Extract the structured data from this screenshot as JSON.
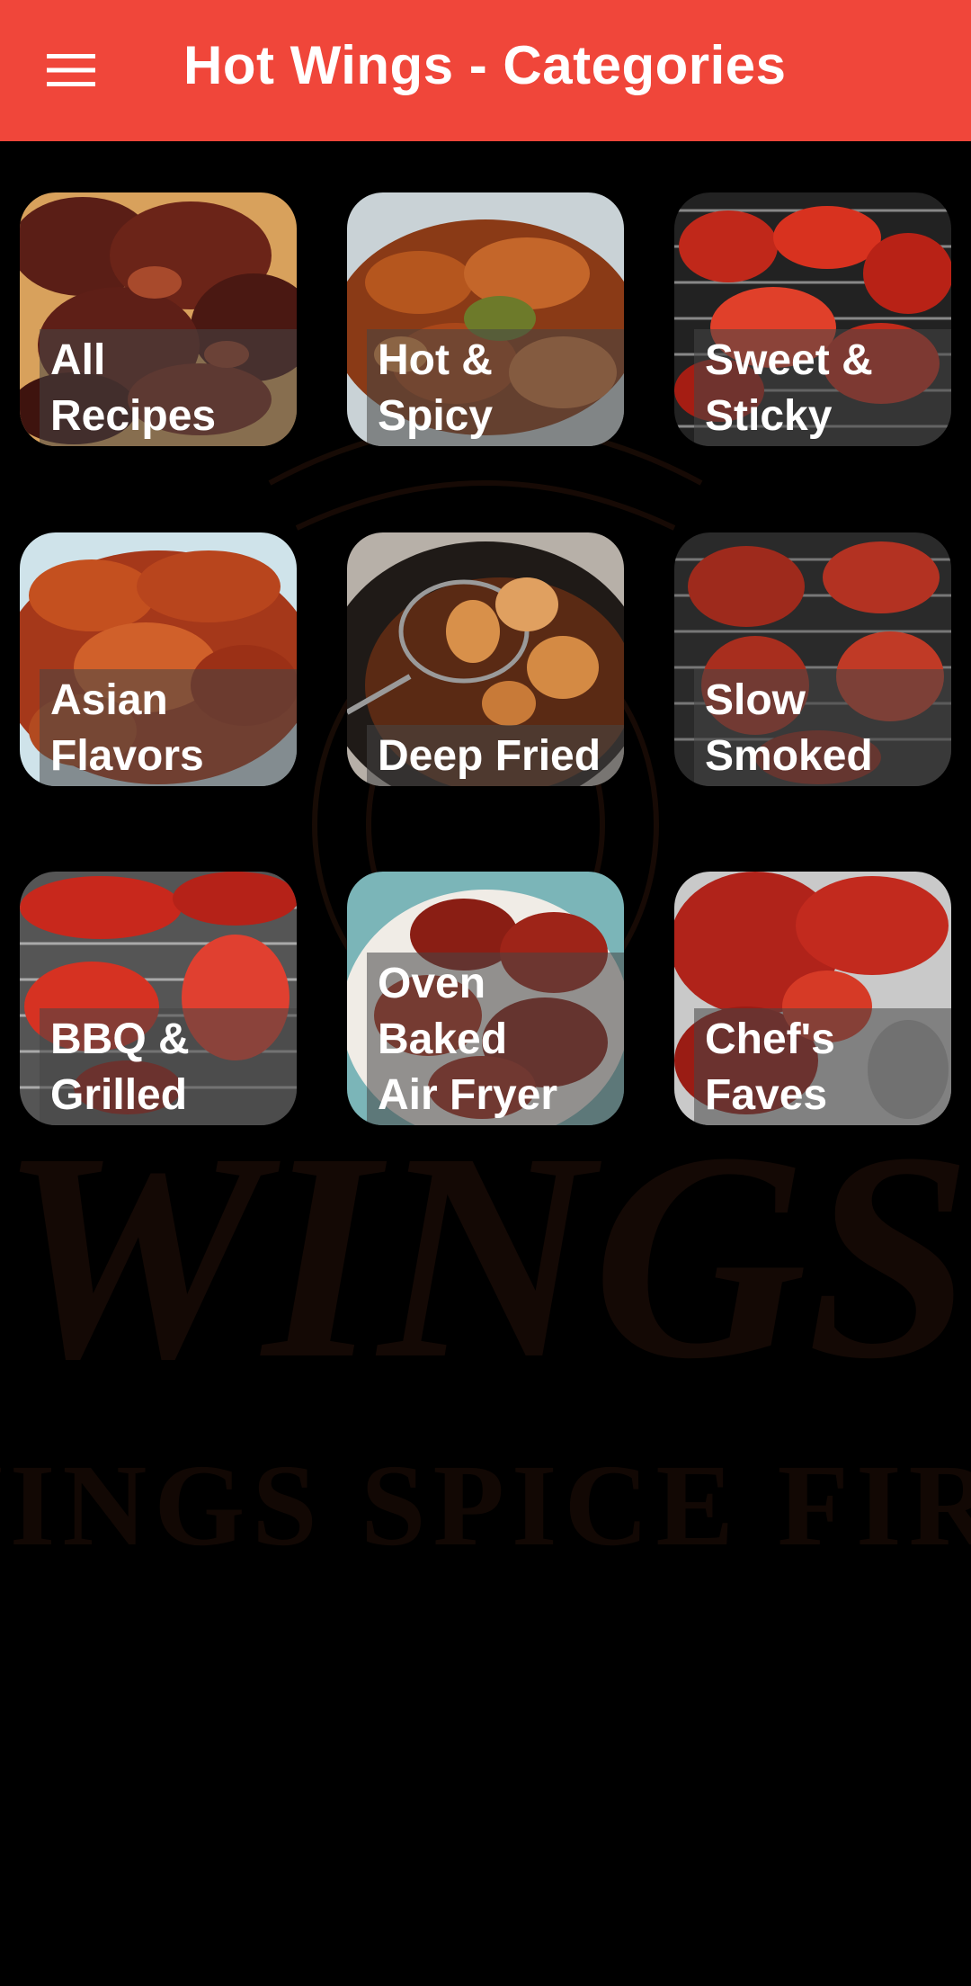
{
  "app_bar": {
    "title": "Hot Wings - Categories",
    "menu_icon": "hamburger-menu-icon",
    "background_color": "#f0463a"
  },
  "background": {
    "color": "#000000",
    "watermark_logo_text": "WINGS",
    "watermark_tagline": "WINGS SPICE FIRE"
  },
  "categories": [
    {
      "id": "all-recipes",
      "label": "All\nRecipes"
    },
    {
      "id": "hot-spicy",
      "label": "Hot &\nSpicy"
    },
    {
      "id": "sweet-sticky",
      "label": "Sweet &\nSticky"
    },
    {
      "id": "asian-flavors",
      "label": "Asian\nFlavors"
    },
    {
      "id": "deep-fried",
      "label": "Deep Fried"
    },
    {
      "id": "slow-smoked",
      "label": "Slow\nSmoked"
    },
    {
      "id": "bbq-grilled",
      "label": "BBQ &\nGrilled"
    },
    {
      "id": "oven-baked-air-fryer",
      "label": "Oven\nBaked\n Air Fryer"
    },
    {
      "id": "chefs-faves",
      "label": "Chef's\nFaves"
    }
  ]
}
